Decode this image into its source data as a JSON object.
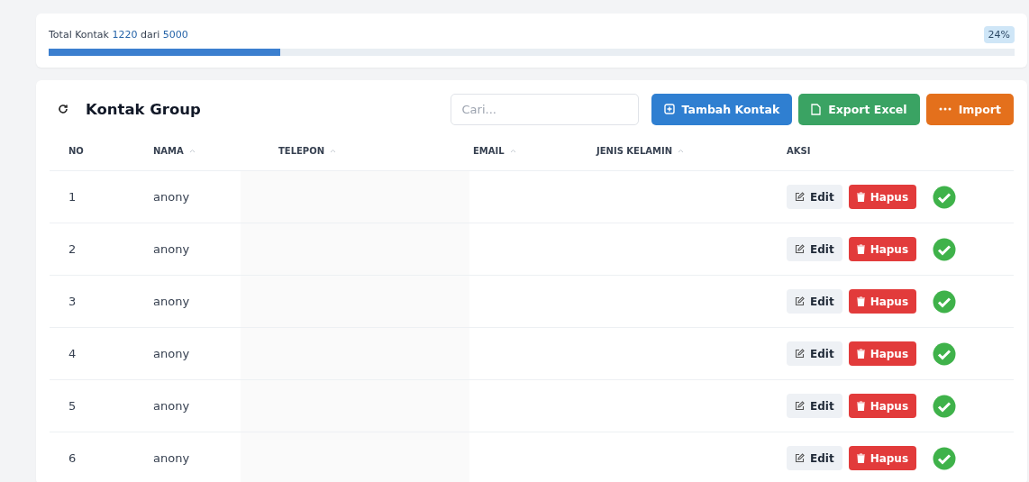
{
  "summary": {
    "label": "Total Kontak",
    "count": "1220",
    "separator": "dari",
    "total": "5000",
    "percent": "24%",
    "level": 0.24
  },
  "header": {
    "title": "Kontak Group",
    "search": {
      "placeholder": "Cari..."
    },
    "buttons": [
      {
        "label": "Tambah Kontak",
        "kind": "add"
      },
      {
        "label": "Export Excel",
        "kind": "export"
      },
      {
        "label": "Import",
        "kind": "import"
      }
    ]
  },
  "table": {
    "columns": [
      {
        "label": "NO",
        "sortable": false
      },
      {
        "label": "NAMA",
        "sortable": true
      },
      {
        "label": "TELEPON",
        "sortable": true
      },
      {
        "label": "EMAIL",
        "sortable": true
      },
      {
        "label": "JENIS KELAMIN",
        "sortable": true
      },
      {
        "label": "AKSI",
        "sortable": false
      }
    ],
    "rows": [
      {
        "no": "1",
        "name": "anony",
        "edit": "Edit",
        "delete": "Hapus"
      },
      {
        "no": "2",
        "name": "anony",
        "edit": "Edit",
        "delete": "Hapus"
      },
      {
        "no": "3",
        "name": "anony",
        "edit": "Edit",
        "delete": "Hapus"
      },
      {
        "no": "4",
        "name": "anony",
        "edit": "Edit",
        "delete": "Hapus"
      },
      {
        "no": "5",
        "name": "anony",
        "edit": "Edit",
        "delete": "Hapus"
      },
      {
        "no": "6",
        "name": "anony",
        "edit": "Edit",
        "delete": "Hapus"
      }
    ]
  }
}
